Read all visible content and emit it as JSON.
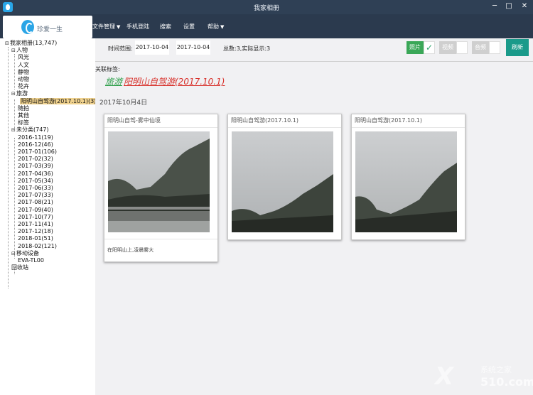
{
  "window": {
    "title": "我家相册",
    "minimize": "─",
    "maximize": "□",
    "close": "✕"
  },
  "app": {
    "logo_text": "珍爱一生"
  },
  "menu": {
    "items": [
      {
        "label": "文件管理",
        "caret": "▼"
      },
      {
        "label": "手机登陆",
        "caret": ""
      },
      {
        "label": "搜索",
        "caret": ""
      },
      {
        "label": "设置",
        "caret": ""
      },
      {
        "label": "帮助",
        "caret": "▼"
      }
    ]
  },
  "tree": {
    "rows": [
      {
        "twisty": "⊟",
        "label": "我家相册(13,747)",
        "level": 0
      },
      {
        "twisty": "⊟",
        "label": "人物",
        "level": 1
      },
      {
        "twisty": "",
        "label": "风光",
        "level": 2
      },
      {
        "twisty": "",
        "label": "人文",
        "level": 2
      },
      {
        "twisty": "",
        "label": "静物",
        "level": 2
      },
      {
        "twisty": "",
        "label": "动物",
        "level": 2
      },
      {
        "twisty": "",
        "label": "花卉",
        "level": 2
      },
      {
        "twisty": "⊟",
        "label": "旅游",
        "level": 1
      },
      {
        "twisty": "",
        "label": "阳明山自驾游(2017.10.1)(3)",
        "level": 2,
        "selected": true
      },
      {
        "twisty": "",
        "label": "随拍",
        "level": 2
      },
      {
        "twisty": "",
        "label": "其他",
        "level": 2
      },
      {
        "twisty": "",
        "label": "标签",
        "level": 2
      },
      {
        "twisty": "⊟",
        "label": "未分类(747)",
        "level": 1
      },
      {
        "twisty": "",
        "label": "2016-11(19)",
        "level": 2
      },
      {
        "twisty": "",
        "label": "2016-12(46)",
        "level": 2
      },
      {
        "twisty": "",
        "label": "2017-01(106)",
        "level": 2
      },
      {
        "twisty": "",
        "label": "2017-02(32)",
        "level": 2
      },
      {
        "twisty": "",
        "label": "2017-03(39)",
        "level": 2
      },
      {
        "twisty": "",
        "label": "2017-04(36)",
        "level": 2
      },
      {
        "twisty": "",
        "label": "2017-05(34)",
        "level": 2
      },
      {
        "twisty": "",
        "label": "2017-06(33)",
        "level": 2
      },
      {
        "twisty": "",
        "label": "2017-07(33)",
        "level": 2
      },
      {
        "twisty": "",
        "label": "2017-08(21)",
        "level": 2
      },
      {
        "twisty": "",
        "label": "2017-09(40)",
        "level": 2
      },
      {
        "twisty": "",
        "label": "2017-10(77)",
        "level": 2
      },
      {
        "twisty": "",
        "label": "2017-11(41)",
        "level": 2
      },
      {
        "twisty": "",
        "label": "2017-12(18)",
        "level": 2
      },
      {
        "twisty": "",
        "label": "2018-01(51)",
        "level": 2
      },
      {
        "twisty": "",
        "label": "2018-02(121)",
        "level": 2
      },
      {
        "twisty": "⊟",
        "label": "移动设备",
        "level": 1
      },
      {
        "twisty": "",
        "label": "EVA-TL00",
        "level": 2
      },
      {
        "twisty": "",
        "label": "回收站",
        "level": 1
      }
    ]
  },
  "filter": {
    "range_label": "时间范围:",
    "start_date": "2017-10-04",
    "end_date": "2017-10-04",
    "count_text": "总数:3,实际显示:3",
    "toggles": [
      {
        "label": "照片",
        "checked": true,
        "check": "✓",
        "color": "#3aa757"
      },
      {
        "label": "视频",
        "checked": false,
        "check": "",
        "color": "#cfcfcf"
      },
      {
        "label": "音频",
        "checked": false,
        "check": "",
        "color": "#cfcfcf"
      }
    ],
    "refresh": "刷新"
  },
  "tags": {
    "label": "关联标签:",
    "tag1": "旅游",
    "tag2": "阳明山自驾游(2017.10.1)"
  },
  "gallery": {
    "date_heading": "2017年10月4日",
    "photos": [
      {
        "title": "阳明山自驾-雾中仙境",
        "caption": "在阳明山上,凌晨雾大"
      },
      {
        "title": "阳明山自驾游(2017.10.1)",
        "caption": ""
      },
      {
        "title": "阳明山自驾游(2017.10.1)",
        "caption": ""
      }
    ]
  },
  "watermark": {
    "mark": "X",
    "line1": "系统之家",
    "line2": "510.com"
  }
}
